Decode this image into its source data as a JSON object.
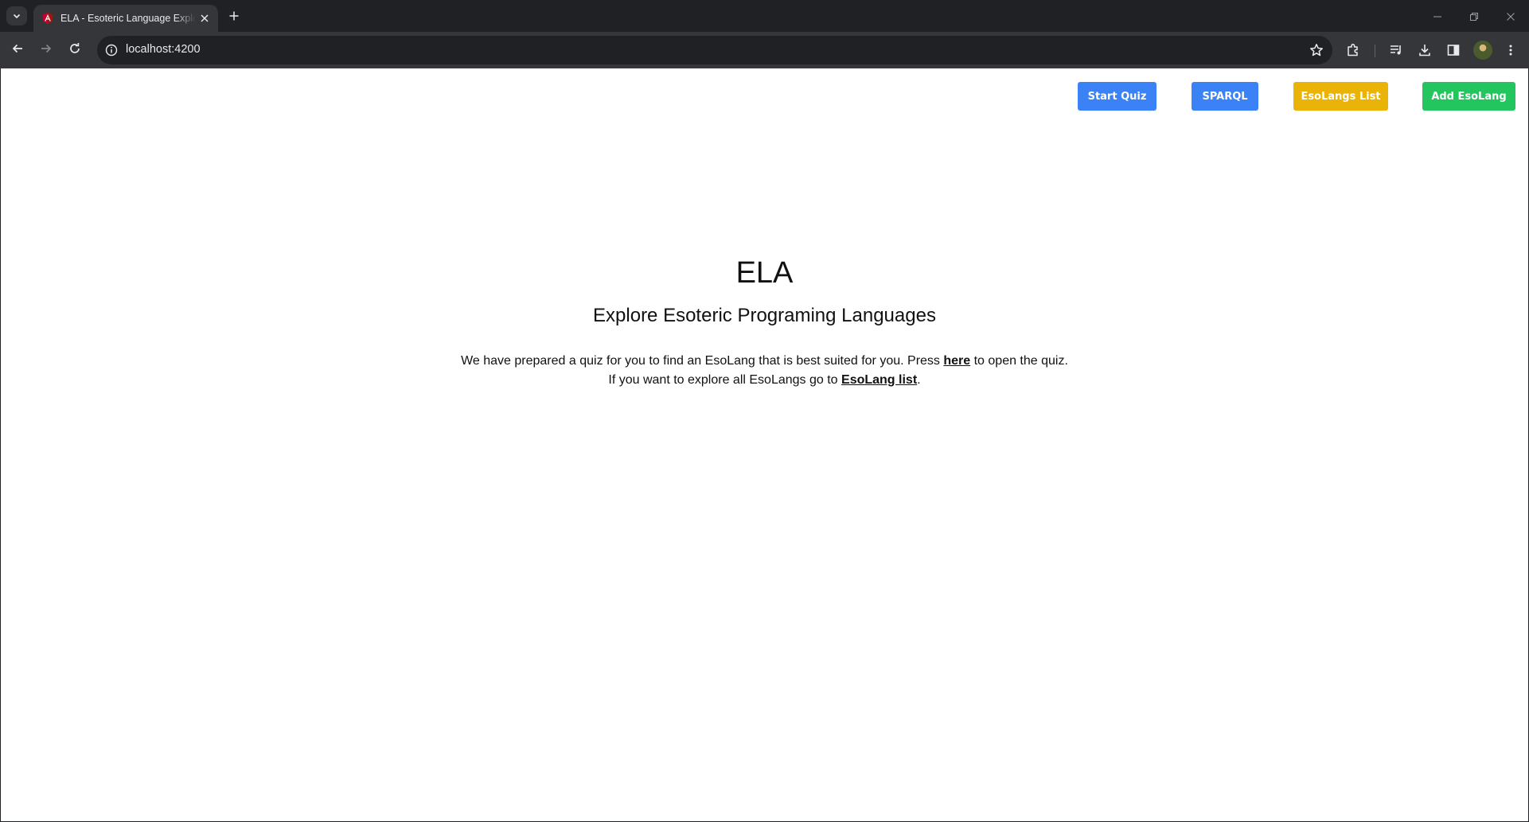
{
  "browser": {
    "tab_title": "ELA - Esoteric Language Explorer",
    "url": "localhost:4200",
    "icons": {
      "tab_search": "chevron-down-icon",
      "favicon": "angular-icon",
      "tab_close": "close-icon",
      "new_tab": "plus-icon",
      "back": "back-arrow-icon",
      "forward": "forward-arrow-icon",
      "reload": "reload-icon",
      "site_info": "info-icon",
      "bookmark": "star-icon",
      "extensions": "puzzle-icon",
      "media": "media-queue-icon",
      "downloads": "download-icon",
      "side_panel": "side-panel-icon",
      "menu": "kebab-menu-icon"
    }
  },
  "nav": {
    "start_quiz": "Start Quiz",
    "sparql": "SPARQL",
    "esolangs_list": "EsoLangs List",
    "add_esolang": "Add EsoLang"
  },
  "colors": {
    "primary_button": "#3b82f6",
    "list_button": "#eab308",
    "add_button": "#22c55e"
  },
  "hero": {
    "title": "ELA",
    "subtitle": "Explore Esoteric Programing Languages",
    "line1_before": "We have prepared a quiz for you to find an EsoLang that is best suited for you. Press ",
    "line1_link": "here",
    "line1_after": " to open the quiz.",
    "line2_before": "If you want to explore all EsoLangs go to ",
    "line2_link": "EsoLang list",
    "line2_after": "."
  }
}
